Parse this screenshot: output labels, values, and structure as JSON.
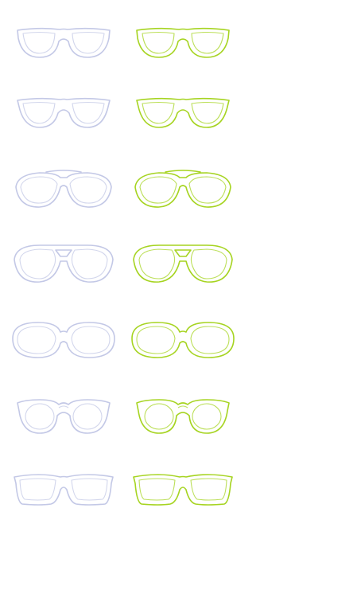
{
  "palette": {
    "outline_variant": "#c3c8e6",
    "highlighted_variant": "#a6d421",
    "background": "#ffffff"
  },
  "glasses": [
    {
      "style": "wayfarer",
      "icon": "wayfarer-glasses-icon"
    },
    {
      "style": "wayfarer-slim",
      "icon": "slim-wayfarer-glasses-icon"
    },
    {
      "style": "aviator",
      "icon": "aviator-glasses-icon"
    },
    {
      "style": "aviator-double-bridge",
      "icon": "double-bridge-aviator-glasses-icon"
    },
    {
      "style": "oversized-round",
      "icon": "oversized-glasses-icon"
    },
    {
      "style": "keyhole-round",
      "icon": "keyhole-glasses-icon"
    },
    {
      "style": "rectangular-sport",
      "icon": "sport-glasses-icon"
    }
  ]
}
